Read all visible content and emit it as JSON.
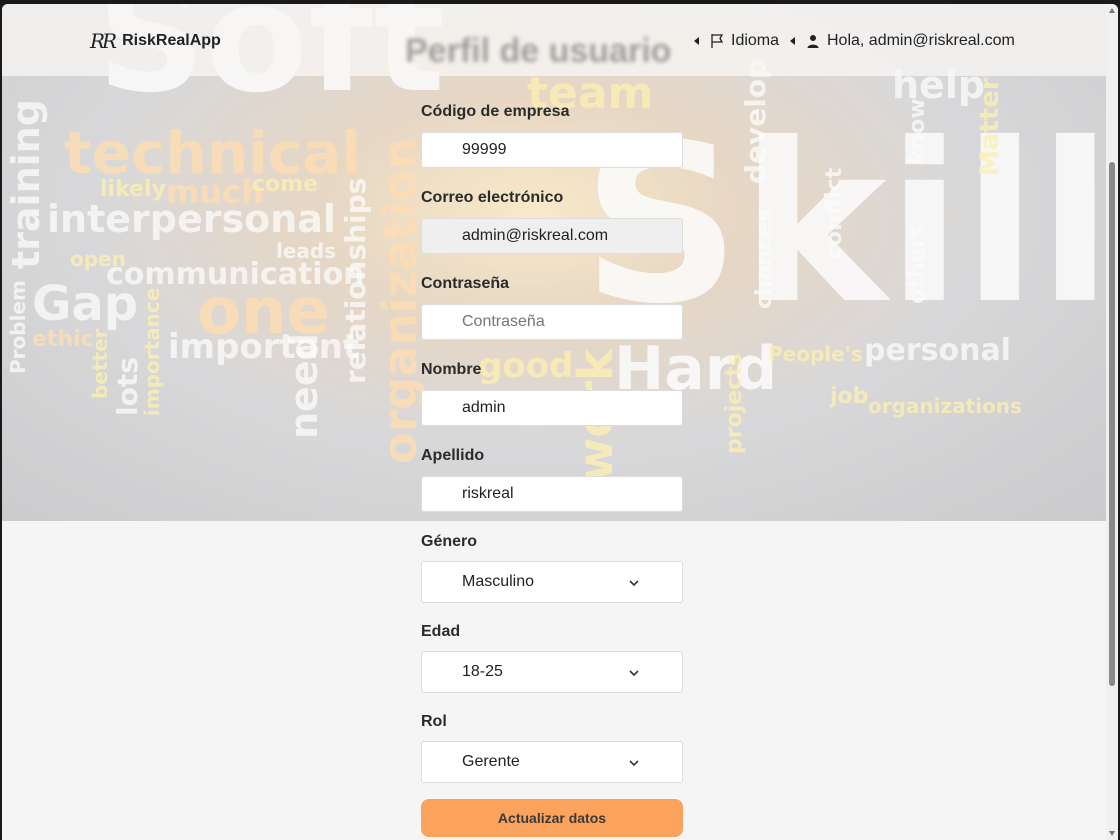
{
  "brand": {
    "logo": "RR",
    "name": "RiskRealApp"
  },
  "page": {
    "title": "Perfil de usuario"
  },
  "nav": {
    "language": "Idioma",
    "greeting": "Hola, admin@riskreal.com"
  },
  "background_words": [
    "Soft",
    "Skills",
    "technical",
    "team",
    "help",
    "training",
    "interpersonal",
    "much",
    "likely",
    "come",
    "Gap",
    "one",
    "communication",
    "important",
    "organization",
    "relationships",
    "Hard",
    "good",
    "People's",
    "personal",
    "organizations",
    "job",
    "others",
    "know",
    "Matter",
    "develop",
    "chances",
    "conflict",
    "need",
    "lots",
    "importance",
    "Problem",
    "ethic",
    "open",
    "leads",
    "projects",
    "work",
    "better"
  ],
  "form": {
    "company_code": {
      "label": "Código de empresa",
      "value": "99999"
    },
    "email": {
      "label": "Correo electrónico",
      "value": "admin@riskreal.com"
    },
    "password": {
      "label": "Contraseña",
      "placeholder": "Contraseña"
    },
    "first_name": {
      "label": "Nombre",
      "value": "admin"
    },
    "last_name": {
      "label": "Apellido",
      "value": "riskreal"
    },
    "gender": {
      "label": "Género",
      "selected": "Masculino"
    },
    "age": {
      "label": "Edad",
      "selected": "18-25"
    },
    "role": {
      "label": "Rol",
      "selected": "Gerente"
    },
    "submit_label": "Actualizar datos"
  },
  "colors": {
    "accent": "#fba25c",
    "page_bg": "#f5f5f5",
    "field_border": "#dcdcdc"
  },
  "icons": {
    "language": "flag-icon",
    "user": "user-icon",
    "select": "chevron-down-icon"
  }
}
